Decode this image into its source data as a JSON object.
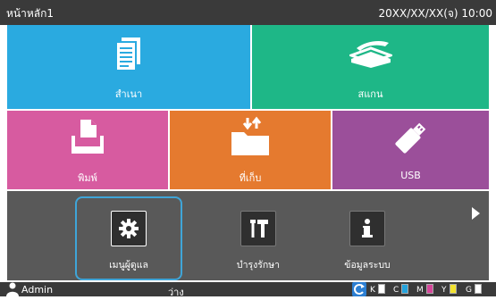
{
  "header": {
    "title": "หน้าหลัก1",
    "datetime": "20XX/XX/XX(จ) 10:00"
  },
  "tiles": {
    "copy": "สำเนา",
    "scan": "สแกน",
    "print": "พิมพ์",
    "storage": "ที่เก็บ",
    "usb": "USB"
  },
  "functions": {
    "admin": "เมนูผู้ดูแล",
    "maintenance": "บำรุงรักษา",
    "system_info": "ข้อมูลระบบ"
  },
  "status": {
    "user": "Admin",
    "state": "ว่าง",
    "inks": [
      {
        "label": "K",
        "color": "#ffffff"
      },
      {
        "label": "C",
        "color": "#25a3dc"
      },
      {
        "label": "M",
        "color": "#d6469a"
      },
      {
        "label": "Y",
        "color": "#f2e230"
      },
      {
        "label": "G",
        "color": "#ffffff"
      }
    ]
  },
  "colors": {
    "copy": "#2aaae0",
    "scan": "#1eb787",
    "print": "#d75ba0",
    "storage": "#e57a2f",
    "usb": "#9b4f9a",
    "panel": "#595959",
    "selection": "#3fa5d8"
  }
}
